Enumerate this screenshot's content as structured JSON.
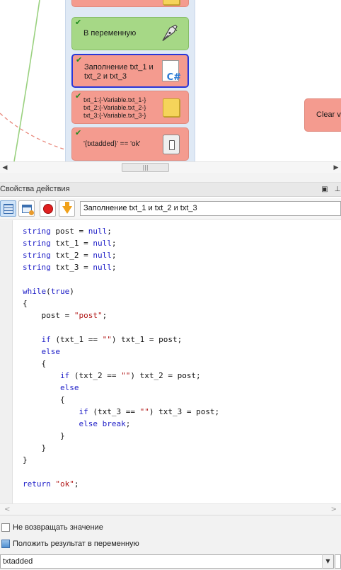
{
  "canvas": {
    "blocks": [
      {
        "id": "top-partial",
        "label": "",
        "icon": "sticky-note-icon",
        "style": "salmon",
        "checked": false
      },
      {
        "id": "to-variable",
        "label": "В переменную",
        "icon": "pen-nib-icon",
        "style": "green",
        "checked": true
      },
      {
        "id": "fill-txt",
        "label_lines": [
          "Заполнение txt_1 и",
          "txt_2 и txt_3"
        ],
        "icon": "csharp-file-icon",
        "style": "salmon",
        "checked": true,
        "selected": true
      },
      {
        "id": "txt-list",
        "label_lines": [
          "txt_1:{-Variable.txt_1-}",
          "txt_2:{-Variable.txt_2-}",
          "txt_3:{-Variable.txt_3-}"
        ],
        "icon": "sticky-note-icon",
        "style": "salmon",
        "checked": true
      },
      {
        "id": "condition",
        "label": "'{txtadded}' == 'ok'",
        "icon": "switch-icon",
        "style": "salmon",
        "checked": true
      }
    ],
    "clear_block_label": "Clear v"
  },
  "panel": {
    "title": "Свойства действия",
    "toolbar": {
      "action_name": "Заполнение txt_1 и txt_2 и txt_3",
      "buttons": [
        "grid-view-icon",
        "window-settings-icon",
        "stop-icon",
        "download-arrow-icon"
      ]
    },
    "code_lines": [
      "string post = null;",
      "string txt_1 = null;",
      "string txt_2 = null;",
      "string txt_3 = null;",
      "",
      "while(true)",
      "{",
      "    post = \"post\";",
      "",
      "    if (txt_1 == \"\") txt_1 = post;",
      "    else",
      "    {",
      "        if (txt_2 == \"\") txt_2 = post;",
      "        else",
      "        {",
      "            if (txt_3 == \"\") txt_3 = post;",
      "            else break;",
      "        }",
      "    }",
      "}",
      "",
      "return \"ok\";"
    ],
    "options": {
      "no_return_label": "Не возвращать значение",
      "no_return_checked": false,
      "put_result_label": "Положить результат в переменную",
      "put_result_checked": true,
      "result_variable": "txtadded"
    }
  }
}
